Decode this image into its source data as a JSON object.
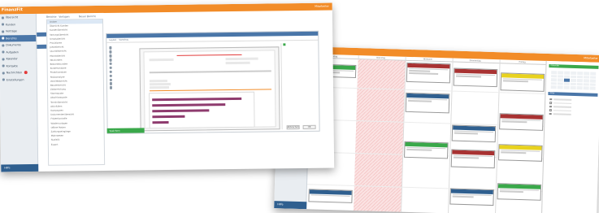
{
  "app": {
    "brand": "FinanzFit",
    "user_label": "Mitarbeiter",
    "accent": "#f28c28",
    "primary": "#4a76a8",
    "success": "#3aa84a"
  },
  "sidebar": {
    "items": [
      {
        "label": "Übersicht",
        "icon": "home-icon"
      },
      {
        "label": "Kunden",
        "icon": "users-icon"
      },
      {
        "label": "Verträge",
        "icon": "document-icon"
      },
      {
        "label": "Berichte",
        "icon": "report-icon",
        "active": true
      },
      {
        "label": "Dokumente",
        "icon": "folder-icon"
      },
      {
        "label": "Aufgaben",
        "icon": "task-icon"
      },
      {
        "label": "Kalender",
        "icon": "calendar-icon"
      },
      {
        "label": "Kontakte",
        "icon": "contact-icon"
      },
      {
        "label": "Nachrichten",
        "icon": "mail-icon",
        "badge": true
      },
      {
        "label": "Einstellungen",
        "icon": "gear-icon"
      }
    ],
    "bottom_label": "Hilfe"
  },
  "reports": {
    "tabs": [
      "Berichte",
      "Vorlagen",
      "Neuer Bericht"
    ],
    "tree_items": [
      "Ordner",
      "Übersicht Kunden",
      "Kundenübersicht",
      "Vertragsübersicht",
      "Umsatzbericht",
      "Provisionen",
      "Jahresbericht",
      "Quartalsbericht",
      "Monatsbericht",
      "Neukunden",
      "Bestandskunden",
      "Kundenanalyse",
      "Produktanalyse",
      "Risikoanalyse",
      "Vertriebsbericht",
      "Beraterbericht",
      "Zielerreichung",
      "Stornoquote",
      "Abschlussquote",
      "Terminübersicht",
      "Aktivitäten",
      "Kampagnen",
      "Dokumentenübersicht",
      "Fristenkontrolle",
      "Wiedervorlagen",
      "Offene Posten",
      "Zahlungseingänge",
      "Mahnwesen",
      "Statistik",
      "Export"
    ],
    "editor_tabs": [
      "Layout",
      "Vorschau"
    ],
    "save_label": "Speichern",
    "cancel_label": "Abbrechen",
    "ok_label": "OK"
  },
  "calendar": {
    "columns": [
      "Montag",
      "Dienstag",
      "Mittwoch",
      "Donnerstag",
      "Freitag"
    ],
    "panel_title": "Kalender",
    "filter_title": "Filter"
  }
}
